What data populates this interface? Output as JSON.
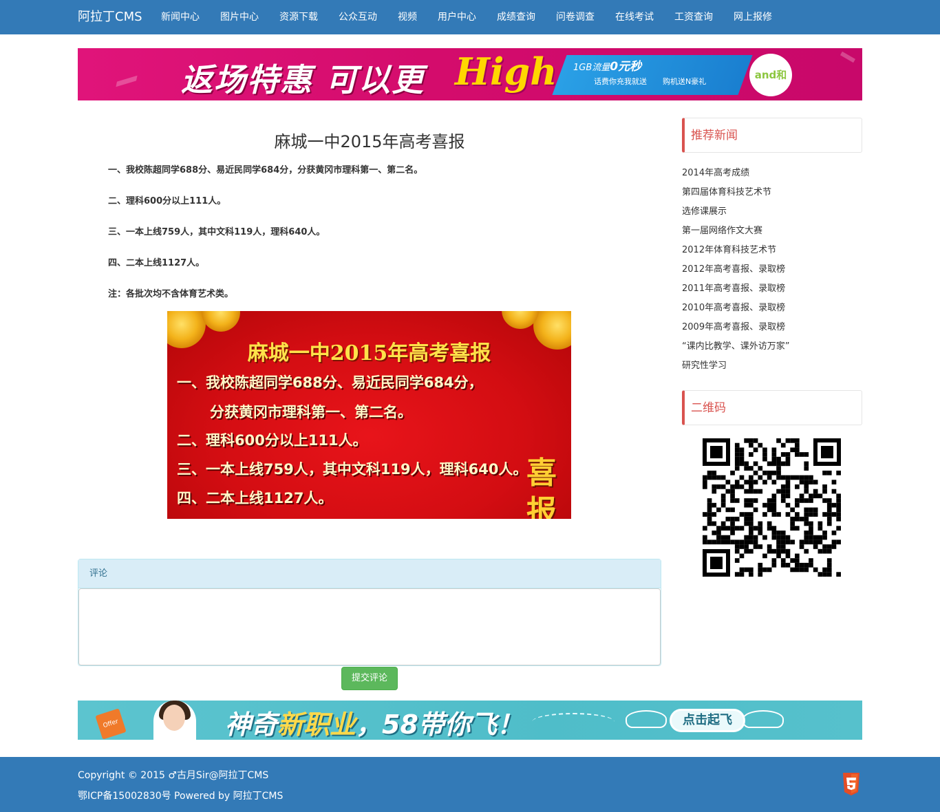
{
  "nav": {
    "brand": "阿拉丁CMS",
    "items": [
      "新闻中心",
      "图片中心",
      "资源下载",
      "公众互动",
      "视频",
      "用户中心",
      "成绩查询",
      "问卷调查",
      "在线考试",
      "工资查询",
      "网上报修"
    ]
  },
  "banner_top": {
    "headline": "返场特惠 可以更",
    "script_word": "High",
    "ribbon_line1_prefix": "1GB流量",
    "ribbon_line1_bold": "0元秒",
    "ribbon_line2a": "话费你充我就送",
    "ribbon_line2b": "购机送N豪礼",
    "logo": "and和"
  },
  "article": {
    "title": "麻城一中2015年高考喜报",
    "lines": [
      "一、我校陈超同学688分、易近民同学684分，分获黄冈市理科第一、第二名。",
      "二、理科600分以上111人。",
      "三、一本上线759人，其中文科119人，理科640人。",
      "四、二本上线1127人。",
      "注：各批次均不含体育艺术类。"
    ],
    "poster": {
      "title": "麻城一中2015年高考喜报",
      "lines": [
        "一、我校陈超同学688分、易近民同学684分，",
        "分获黄冈市理科第一、第二名。",
        "二、理科600分以上111人。",
        "三、一本上线759人，其中文科119人，理科640人。",
        "四、二本上线1127人。"
      ],
      "side_glyphs": "喜\n报"
    }
  },
  "comments": {
    "header": "评论",
    "textarea_value": "",
    "submit_label": "提交评论"
  },
  "banner_bottom": {
    "offer_tag": "Offer",
    "headline_a": "神奇",
    "headline_b": "新职业",
    "headline_c": "，58带你飞！",
    "button": "点击起飞"
  },
  "sidebar": {
    "recommended_title": "推荐新闻",
    "news": [
      "2014年高考成绩",
      "第四届体育科技艺术节",
      "选修课展示",
      "第一届网络作文大赛",
      "2012年体育科技艺术节",
      "2012年高考喜报、录取榜",
      "2011年高考喜报、录取榜",
      "2010年高考喜报、录取榜",
      "2009年高考喜报、录取榜",
      "“课内比教学、课外访万家”",
      "研究性学习"
    ],
    "qr_title": "二维码"
  },
  "footer": {
    "copyright": "Copyright © 2015 ♂古月Sir@阿拉丁CMS",
    "icp": "鄂ICP备15002830号 Powered by 阿拉丁CMS",
    "badge_icon": "html5-icon"
  },
  "colors": {
    "nav_bg": "#337ab7",
    "accent_red": "#d9534f",
    "btn_green": "#5cb85c",
    "info_bg": "#d9edf7"
  }
}
